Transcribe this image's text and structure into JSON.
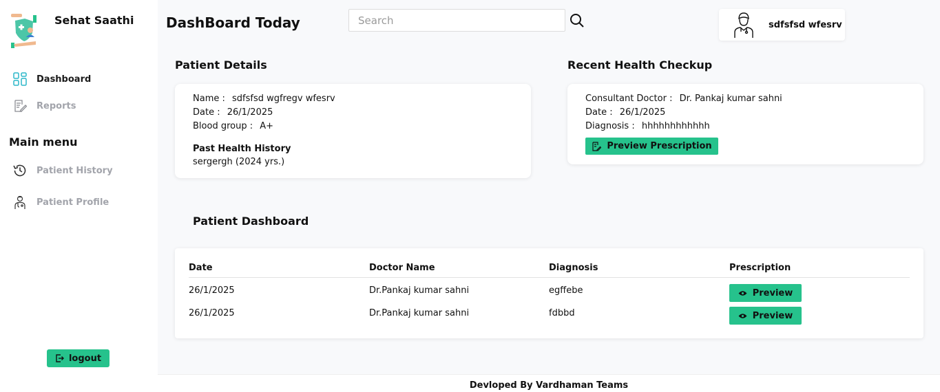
{
  "sidebar": {
    "brand": "Sehat Saathi",
    "items": [
      {
        "label": "Dashboard",
        "icon": "dashboard-grid-icon"
      },
      {
        "label": "Reports",
        "icon": "report-edit-icon"
      }
    ],
    "menu_title": "Main menu",
    "menu_items": [
      {
        "label": "Patient History",
        "icon": "history-clock-icon"
      },
      {
        "label": "Patient Profile",
        "icon": "doctor-profile-icon"
      }
    ],
    "logout_label": "logout"
  },
  "header": {
    "title": "DashBoard Today",
    "search_placeholder": "Search",
    "user_name": "sdfsfsd wfesrv"
  },
  "patient_details": {
    "section_title": "Patient Details",
    "name_label": "Name :",
    "name": "sdfsfsd wgfregv wfesrv",
    "date_label": "Date :",
    "date": "26/1/2025",
    "blood_label": "Blood group :",
    "blood_group": "A+",
    "history_title": "Past Health History",
    "history": "sergergh (2024 yrs.)"
  },
  "recent_checkup": {
    "section_title": "Recent Health Checkup",
    "doctor_label": "Consultant Doctor :",
    "doctor": "Dr. Pankaj kumar sahni",
    "date_label": "Date :",
    "date": "26/1/2025",
    "diagnosis_label": "Diagnosis :",
    "diagnosis": "hhhhhhhhhhhh",
    "button_label": "Preview Prescription"
  },
  "dashboard_table": {
    "section_title": "Patient Dashboard",
    "headers": [
      "Date",
      "Doctor Name",
      "Diagnosis",
      "Prescription"
    ],
    "rows": [
      {
        "date": "26/1/2025",
        "doctor": "Dr.Pankaj kumar sahni",
        "diagnosis": "egffebe",
        "action": "Preview"
      },
      {
        "date": "26/1/2025",
        "doctor": "Dr.Pankaj kumar sahni",
        "diagnosis": "fdbbd",
        "action": "Preview"
      }
    ]
  },
  "footer": {
    "text": "Devloped By Vardhaman Teams"
  },
  "colors": {
    "accent": "#26c28c",
    "background": "#f8f9fb",
    "muted_text": "#a2a4ab"
  }
}
